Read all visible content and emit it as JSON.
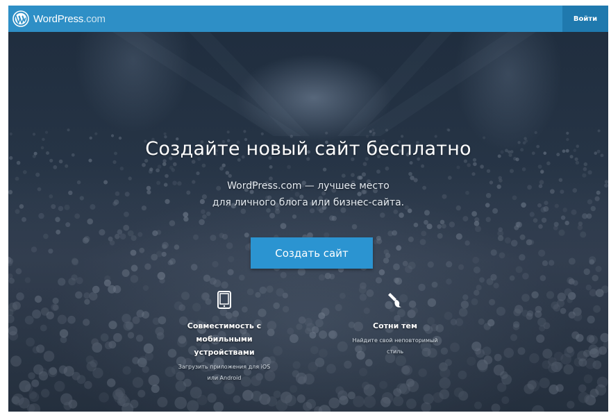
{
  "header": {
    "brand_name": "WordPress",
    "brand_suffix": ".com",
    "login_label": "Войти",
    "brand_color": "#2e8fc6"
  },
  "hero": {
    "headline": "Создайте новый сайт бесплатно",
    "subtext_line1": "WordPress.com — лучшее место",
    "subtext_line2": "для личного блога или бизнес-сайта.",
    "cta_label": "Создать сайт",
    "cta_color": "#2b94d1"
  },
  "features": [
    {
      "icon": "tablet-icon",
      "title_line1": "Совместимость с",
      "title_line2": "мобильными",
      "title_line3": "устройствами",
      "desc_line1": "Загрузить приложения для iOS",
      "desc_line2": "или Android"
    },
    {
      "icon": "paintbrush-icon",
      "title_line1": "Сотни тем",
      "desc_line1": "Найдите свой неповторимый",
      "desc_line2": "стиль"
    }
  ]
}
